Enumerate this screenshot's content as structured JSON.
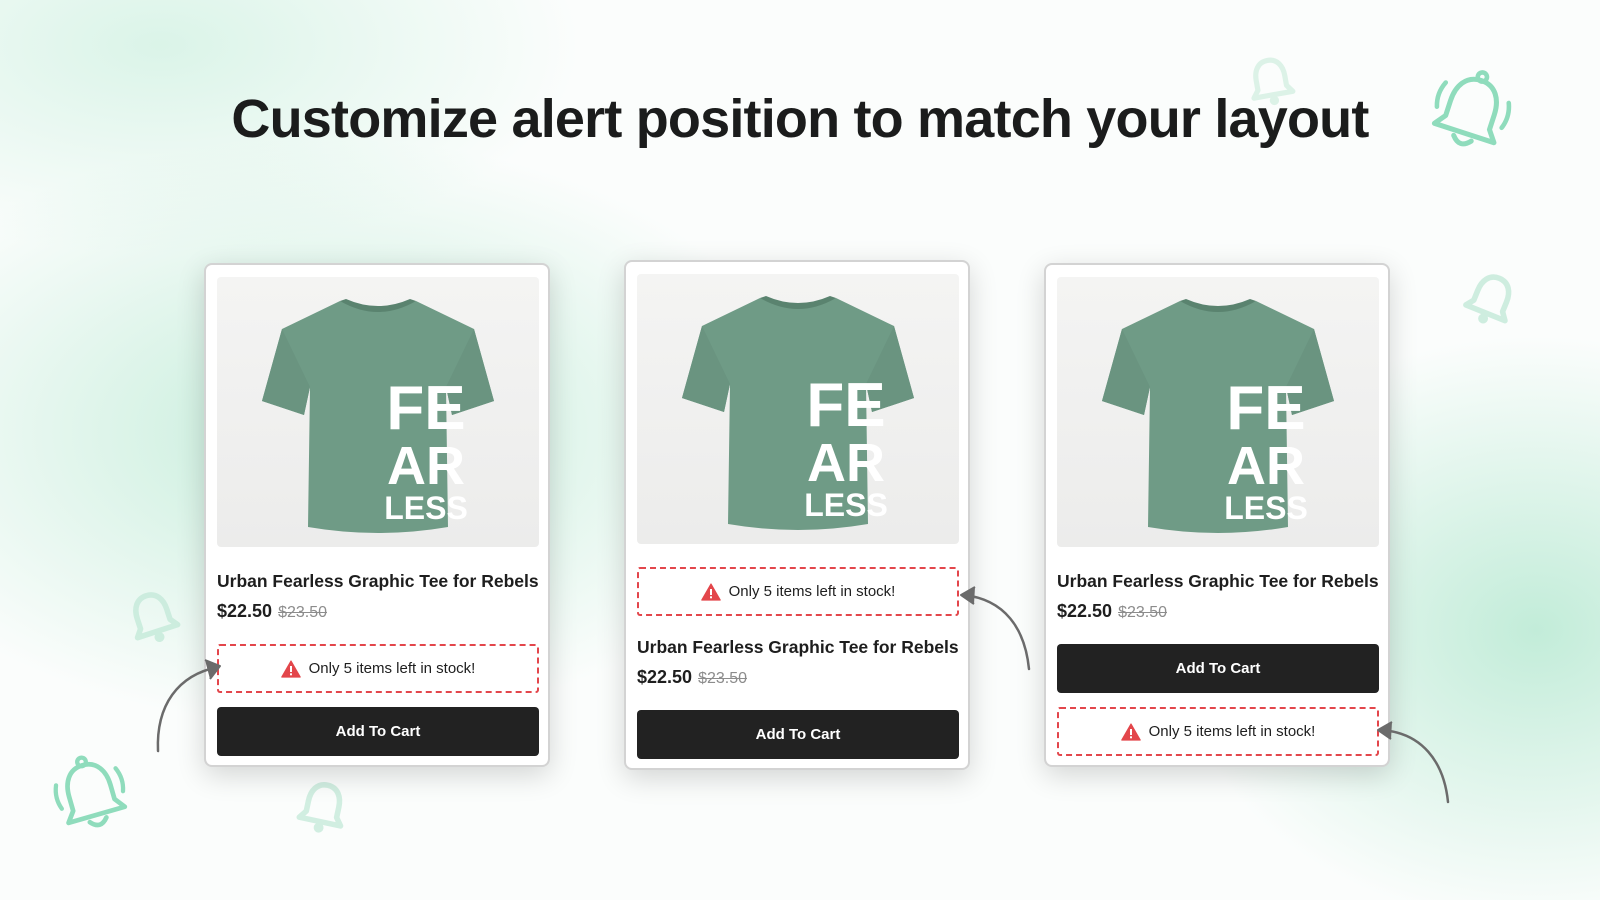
{
  "headline": "Customize alert position to match your layout",
  "colors": {
    "accent_green": "#8fdcbc",
    "shirt_green": "#6f9b86",
    "alert_red": "#e3464b",
    "button_dark": "#222222"
  },
  "cards": [
    {
      "alert_position": "below-price",
      "print_lines": [
        "FE",
        "AR",
        "LESS"
      ],
      "title": "Urban Fearless Graphic Tee for Rebels",
      "price": "$22.50",
      "compare_price": "$23.50",
      "alert_text": "Only 5 items left in stock!",
      "alert_icon": "warning-triangle-icon",
      "button_label": "Add To Cart"
    },
    {
      "alert_position": "above-title",
      "print_lines": [
        "FE",
        "AR",
        "LESS"
      ],
      "title": "Urban Fearless Graphic Tee for Rebels",
      "price": "$22.50",
      "compare_price": "$23.50",
      "alert_text": "Only 5 items left in stock!",
      "alert_icon": "warning-triangle-icon",
      "button_label": "Add To Cart"
    },
    {
      "alert_position": "below-button",
      "print_lines": [
        "FE",
        "AR",
        "LESS"
      ],
      "title": "Urban Fearless Graphic Tee for Rebels",
      "price": "$22.50",
      "compare_price": "$23.50",
      "alert_text": "Only 5 items left in stock!",
      "alert_icon": "warning-triangle-icon",
      "button_label": "Add To Cart"
    }
  ],
  "decorations": [
    "bell-icon",
    "bell-icon",
    "bell-icon",
    "bell-icon",
    "bell-icon",
    "bell-icon",
    "curved-arrow-icon",
    "curved-arrow-icon",
    "curved-arrow-icon"
  ]
}
